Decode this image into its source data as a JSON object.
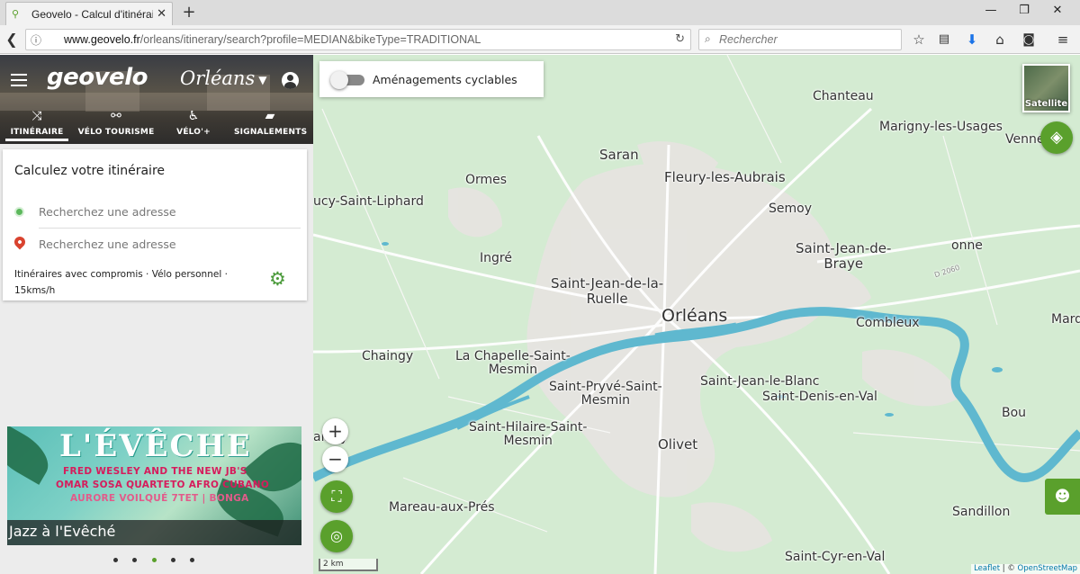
{
  "browser": {
    "tab_title": "Geovelo - Calcul d'itinéraire",
    "tab_close": "✕",
    "new_tab": "+",
    "url_host": "www.geovelo.fr",
    "url_path": "/orleans/itinerary/search?profile=MEDIAN&bikeType=TRADITIONAL",
    "search_placeholder": "Rechercher"
  },
  "header": {
    "logo": "geovelo",
    "city": "Orléans",
    "tabs": [
      {
        "label": "ITINÉRAIRE",
        "icon": "route-icon",
        "active": true
      },
      {
        "label": "VÉLO TOURISME",
        "icon": "bike-icon",
        "active": false
      },
      {
        "label": "VÉLO'+",
        "icon": "bike-plus-icon",
        "active": false
      },
      {
        "label": "SIGNALEMENTS",
        "icon": "report-icon",
        "active": false
      }
    ]
  },
  "itinerary": {
    "title": "Calculez votre itinéraire",
    "origin_placeholder": "Recherchez une adresse",
    "destination_placeholder": "Recherchez une adresse",
    "preferences_line1": "Itinéraires avec compromis · Vélo personnel ·",
    "preferences_line2": "15kms/h"
  },
  "banner": {
    "title": "L'ÉVÊCHE",
    "line1": "FRED WESLEY AND THE NEW JB'S",
    "line2": "OMAR SOSA QUARTETO AFRO CUBANO",
    "line3": "AURORE VOILQUÉ 7TET | BONGA",
    "caption": "Jazz à l'Evêché",
    "slides": 5,
    "active_slide": 3
  },
  "map": {
    "toggle_label": "Aménagements cyclables",
    "satellite_label": "Satellite",
    "zoom_in": "+",
    "zoom_out": "−",
    "scale": "2 km",
    "attribution_leaflet": "Leaflet",
    "attribution_sep": " | © ",
    "attribution_osm": "OpenStreetMap",
    "road_label": "D 2060",
    "places": [
      {
        "name": "Chanteau"
      },
      {
        "name": "Marigny-les-Usages"
      },
      {
        "name": "Venne"
      },
      {
        "name": "Saran"
      },
      {
        "name": "Fleury-les-Aubrais"
      },
      {
        "name": "Ormes"
      },
      {
        "name": "Semoy"
      },
      {
        "name": "ucy-Saint-Liphard"
      },
      {
        "name": "Saint-Jean-de-\nBraye"
      },
      {
        "name": "onne"
      },
      {
        "name": "Ingré"
      },
      {
        "name": "Saint-Jean-de-la-\nRuelle"
      },
      {
        "name": "Orléans"
      },
      {
        "name": "Combleux"
      },
      {
        "name": "Mardié"
      },
      {
        "name": "Chaingy"
      },
      {
        "name": "La Chapelle-Saint-\nMesmin"
      },
      {
        "name": "Saint-Pryvé-Saint-\nMesmin"
      },
      {
        "name": "Saint-Jean-le-Blanc"
      },
      {
        "name": "Saint-Denis-en-Val"
      },
      {
        "name": "Bou"
      },
      {
        "name": "Saint-Hilaire-Saint-\nMesmin"
      },
      {
        "name": "Olivet"
      },
      {
        "name": "aingy"
      },
      {
        "name": "Mareau-aux-Prés"
      },
      {
        "name": "Sandillon"
      },
      {
        "name": "Saint-Cyr-en-Val"
      }
    ]
  },
  "colors": {
    "brand_green": "#5aa02c",
    "river": "#5fb8cf",
    "map_bg": "#d4ebd2"
  }
}
